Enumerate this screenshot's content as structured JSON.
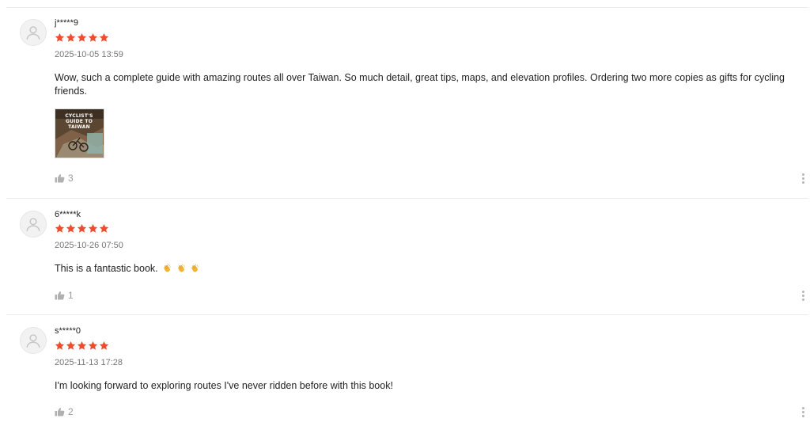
{
  "accent_color": "#ee4d2d",
  "reviews": [
    {
      "username": "j*****9",
      "rating": 5,
      "date": "2025-10-05 13:59",
      "text": "Wow, such a complete guide with amazing routes all over Taiwan. So much detail, great tips, maps, and elevation profiles. Ordering two more copies as gifts for cycling friends.",
      "photo": {
        "cover_title": "CYCLIST'S GUIDE TO TAIWAN"
      },
      "likes": "3"
    },
    {
      "username": "6*****k",
      "rating": 5,
      "date": "2025-10-26 07:50",
      "text": "This is a fantastic book.",
      "emojis": [
        "clapping-hands",
        "clapping-hands",
        "clapping-hands"
      ],
      "likes": "1"
    },
    {
      "username": "s*****0",
      "rating": 5,
      "date": "2025-11-13 17:28",
      "text": "I'm looking forward to exploring routes I've never ridden before with this book!",
      "likes": "2"
    }
  ]
}
